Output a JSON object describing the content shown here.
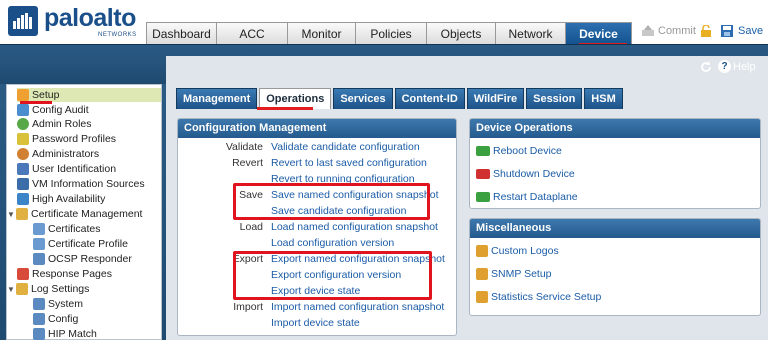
{
  "brand": {
    "name": "paloalto",
    "sub": "NETWORKS"
  },
  "colors": {
    "accent": "#1a5fa8",
    "highlight": "#e0141f",
    "header_bg": "#234f78"
  },
  "top_tabs": [
    "Dashboard",
    "ACC",
    "Monitor",
    "Policies",
    "Objects",
    "Network",
    "Device"
  ],
  "active_top_tab": "Device",
  "toolbar": {
    "commit_label": "Commit",
    "save_label": "Save",
    "help_label": "Help"
  },
  "sidebar": {
    "items": [
      {
        "label": "Setup",
        "icon": "setup-icon"
      },
      {
        "label": "Config Audit",
        "icon": "audit-icon"
      },
      {
        "label": "Admin Roles",
        "icon": "roles-icon"
      },
      {
        "label": "Password Profiles",
        "icon": "password-icon"
      },
      {
        "label": "Administrators",
        "icon": "admin-icon"
      },
      {
        "label": "User Identification",
        "icon": "userid-icon"
      },
      {
        "label": "VM Information Sources",
        "icon": "vm-icon"
      },
      {
        "label": "High Availability",
        "icon": "ha-icon"
      },
      {
        "label": "Certificate Management",
        "icon": "cert-folder-icon"
      },
      {
        "label": "Certificates",
        "icon": "cert-icon"
      },
      {
        "label": "Certificate Profile",
        "icon": "cert-profile-icon"
      },
      {
        "label": "OCSP Responder",
        "icon": "ocsp-icon"
      },
      {
        "label": "Response Pages",
        "icon": "response-icon"
      },
      {
        "label": "Log Settings",
        "icon": "log-folder-icon"
      },
      {
        "label": "System",
        "icon": "log-icon"
      },
      {
        "label": "Config",
        "icon": "log-icon"
      },
      {
        "label": "HIP Match",
        "icon": "log-icon"
      }
    ]
  },
  "sub_tabs": [
    "Management",
    "Operations",
    "Services",
    "Content-ID",
    "WildFire",
    "Session",
    "HSM"
  ],
  "active_sub_tab": "Operations",
  "config_mgmt": {
    "title": "Configuration Management",
    "rows": [
      {
        "label": "Validate",
        "link": "Validate candidate configuration"
      },
      {
        "label": "Revert",
        "link": "Revert to last saved configuration"
      },
      {
        "label": "",
        "link": "Revert to running configuration"
      },
      {
        "label": "Save",
        "link": "Save named configuration snapshot"
      },
      {
        "label": "",
        "link": "Save candidate configuration"
      },
      {
        "label": "Load",
        "link": "Load named configuration snapshot"
      },
      {
        "label": "",
        "link": "Load configuration version"
      },
      {
        "label": "Export",
        "link": "Export named configuration snapshot"
      },
      {
        "label": "",
        "link": "Export configuration version"
      },
      {
        "label": "",
        "link": "Export device state"
      },
      {
        "label": "Import",
        "link": "Import named configuration snapshot"
      },
      {
        "label": "",
        "link": "Import device state"
      }
    ]
  },
  "device_ops": {
    "title": "Device Operations",
    "items": [
      "Reboot Device",
      "Shutdown Device",
      "Restart Dataplane"
    ]
  },
  "misc": {
    "title": "Miscellaneous",
    "items": [
      "Custom Logos",
      "SNMP Setup",
      "Statistics Service Setup"
    ]
  }
}
